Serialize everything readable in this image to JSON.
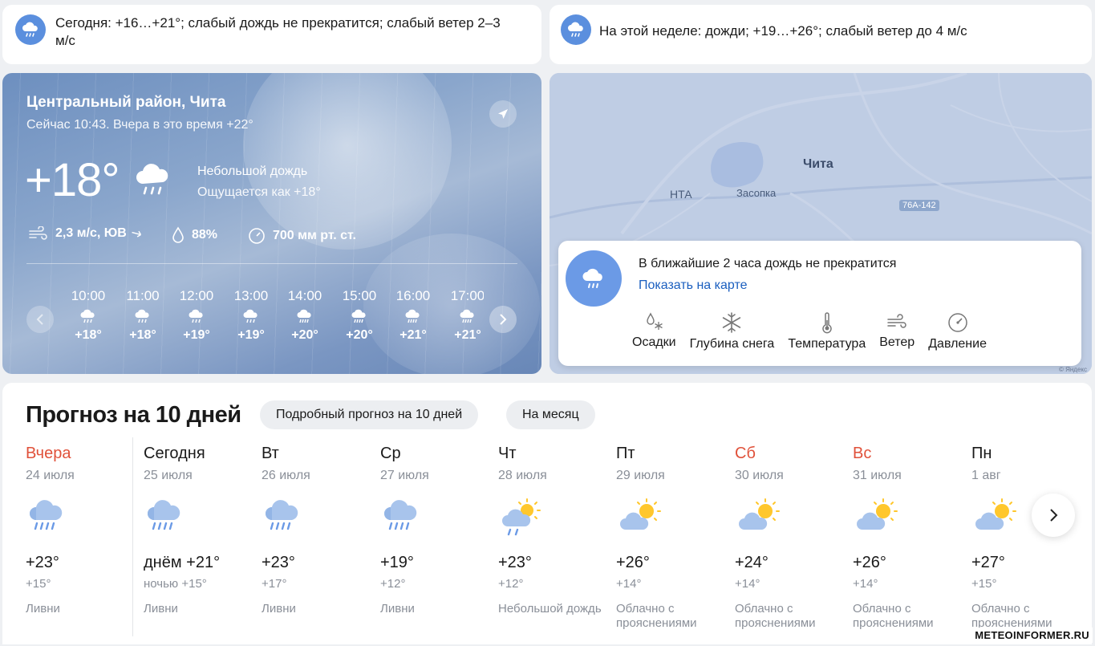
{
  "summary_today": {
    "text": "Сегодня: +16…+21°; слабый дождь не прекратится; слабый ветер 2–3 м/с"
  },
  "summary_week": {
    "text": "На этой неделе: дожди; +19…+26°; слабый ветер до 4 м/с"
  },
  "hero": {
    "location": "Центральный район, Чита",
    "now_line": "Сейчас 10:43. Вчера в это время +22°",
    "temp": "+18°",
    "condition": "Небольшой дождь",
    "feels_like": "Ощущается как +18°",
    "wind": "2,3 м/с, ЮВ",
    "humidity": "88%",
    "pressure": "700 мм рт. ст.",
    "hours": [
      {
        "time": "10:00",
        "temp": "+18°"
      },
      {
        "time": "11:00",
        "temp": "+18°"
      },
      {
        "time": "12:00",
        "temp": "+19°"
      },
      {
        "time": "13:00",
        "temp": "+19°"
      },
      {
        "time": "14:00",
        "temp": "+20°"
      },
      {
        "time": "15:00",
        "temp": "+20°"
      },
      {
        "time": "16:00",
        "temp": "+21°"
      },
      {
        "time": "17:00",
        "temp": "+21°"
      }
    ]
  },
  "map": {
    "city": "Чита",
    "labels": {
      "airport": "НТА",
      "village": "Засопка",
      "road": "76А-142"
    },
    "message": "В ближайшие 2 часа дождь не прекратится",
    "link": "Показать на карте",
    "layers": [
      "Осадки",
      "Глубина снега",
      "Температура",
      "Ветер",
      "Давление"
    ],
    "copyright": "© Яндекс"
  },
  "forecast": {
    "title": "Прогноз на 10 дней",
    "chip_detailed": "Подробный прогноз на 10 дней",
    "chip_month": "На месяц",
    "days": [
      {
        "name": "Вчера",
        "date": "24 июля",
        "hi": "+23°",
        "lo": "+15°",
        "desc": "Ливни",
        "icon": "rain-cloud",
        "weekend": true
      },
      {
        "name": "Сегодня",
        "date": "25 июля",
        "hi": "днём +21°",
        "lo": "ночью +15°",
        "desc": "Ливни",
        "icon": "rain-cloud",
        "weekend": false
      },
      {
        "name": "Вт",
        "date": "26 июля",
        "hi": "+23°",
        "lo": "+17°",
        "desc": "Ливни",
        "icon": "rain-cloud",
        "weekend": false
      },
      {
        "name": "Ср",
        "date": "27 июля",
        "hi": "+19°",
        "lo": "+12°",
        "desc": "Ливни",
        "icon": "rain-cloud",
        "weekend": false
      },
      {
        "name": "Чт",
        "date": "28 июля",
        "hi": "+23°",
        "lo": "+12°",
        "desc": "Небольшой дождь",
        "icon": "sun-cloud-rain",
        "weekend": false
      },
      {
        "name": "Пт",
        "date": "29 июля",
        "hi": "+26°",
        "lo": "+14°",
        "desc": "Облачно с прояснениями",
        "icon": "sun-cloud",
        "weekend": false
      },
      {
        "name": "Сб",
        "date": "30 июля",
        "hi": "+24°",
        "lo": "+14°",
        "desc": "Облачно с прояснениями",
        "icon": "sun-cloud",
        "weekend": true
      },
      {
        "name": "Вс",
        "date": "31 июля",
        "hi": "+26°",
        "lo": "+14°",
        "desc": "Облачно с прояснениями",
        "icon": "sun-cloud",
        "weekend": true
      },
      {
        "name": "Пн",
        "date": "1 авг",
        "hi": "+27°",
        "lo": "+15°",
        "desc": "Облачно с прояснениями",
        "icon": "sun-cloud",
        "weekend": false
      }
    ]
  },
  "watermark": "METEOINFORMER.RU",
  "colors": {
    "accent": "#5b8fde",
    "weekend": "#e0513a",
    "link": "#1b5fbf"
  }
}
